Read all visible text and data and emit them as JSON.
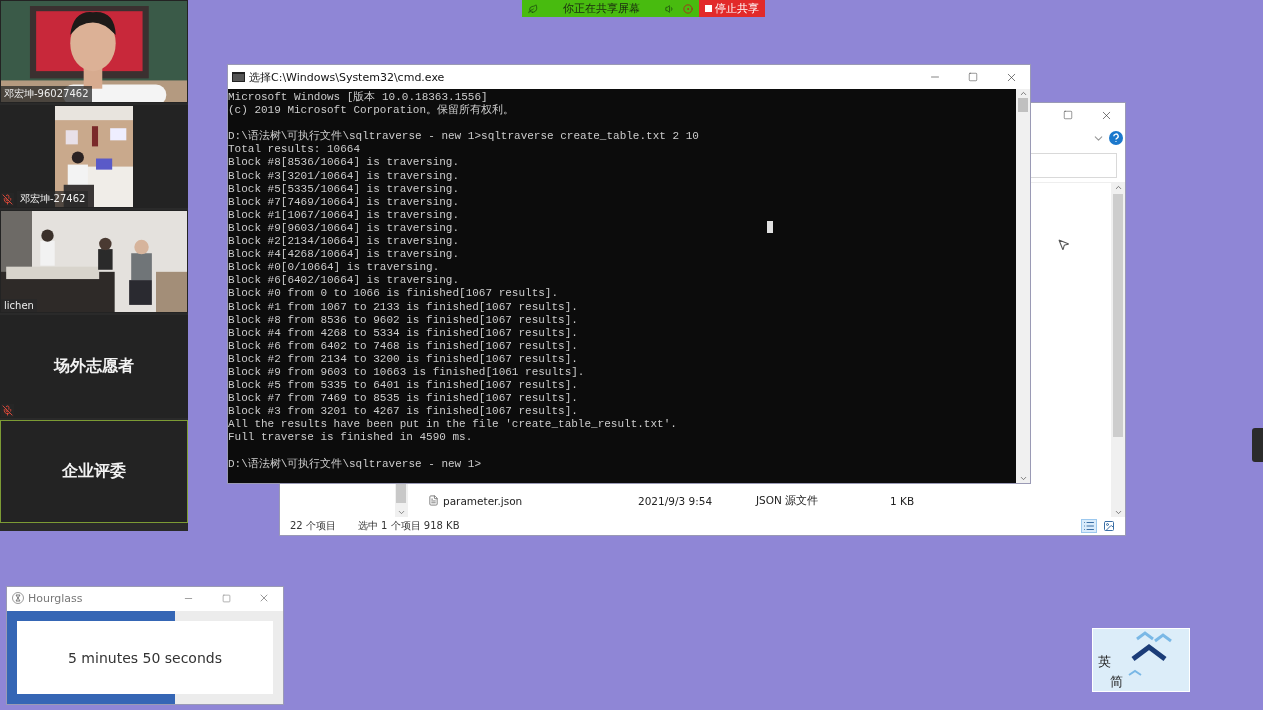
{
  "screen_share_bar": {
    "status": "你正在共享屏幕",
    "stop_button": "停止共享"
  },
  "participants": [
    {
      "kind": "video",
      "name": "邓宏坤-96027462",
      "muted": false,
      "selected": false
    },
    {
      "kind": "narrow_video",
      "name": "邓宏坤-27462",
      "muted": true,
      "selected": false
    },
    {
      "kind": "video",
      "name": "lichen",
      "muted": false,
      "selected": false
    },
    {
      "kind": "placeholder",
      "name": "场外志愿者",
      "muted": true,
      "selected": false
    },
    {
      "kind": "placeholder",
      "name": "企业评委",
      "muted": false,
      "selected": true
    }
  ],
  "cmd_window": {
    "title": "选择C:\\Windows\\System32\\cmd.exe",
    "blocks": [
      [
        "Microsoft Windows [版本 10.0.18363.1556]",
        "(c) 2019 Microsoft Corporation。保留所有权利。"
      ],
      [
        "D:\\语法树\\可执行文件\\sqltraverse - new 1>sqltraverse create_table.txt 2 10",
        "Total results: 10664",
        "Block #8[8536/10664] is traversing.",
        "Block #3[3201/10664] is traversing.",
        "Block #5[5335/10664] is traversing.",
        "Block #7[7469/10664] is traversing.",
        "Block #1[1067/10664] is traversing.",
        "Block #9[9603/10664] is traversing.",
        "Block #2[2134/10664] is traversing.",
        "Block #4[4268/10664] is traversing.",
        "Block #0[0/10664] is traversing.",
        "Block #6[6402/10664] is traversing.",
        "Block #0 from 0 to 1066 is finished[1067 results].",
        "Block #1 from 1067 to 2133 is finished[1067 results].",
        "Block #8 from 8536 to 9602 is finished[1067 results].",
        "Block #4 from 4268 to 5334 is finished[1067 results].",
        "Block #6 from 6402 to 7468 is finished[1067 results].",
        "Block #2 from 2134 to 3200 is finished[1067 results].",
        "Block #9 from 9603 to 10663 is finished[1061 results].",
        "Block #5 from 5335 to 6401 is finished[1067 results].",
        "Block #7 from 7469 to 8535 is finished[1067 results].",
        "Block #3 from 3201 to 4267 is finished[1067 results].",
        "All the results have been put in the file 'create_table_result.txt'.",
        "Full traverse is finished in 4590 ms."
      ],
      [
        "D:\\语法树\\可执行文件\\sqltraverse - new 1>"
      ]
    ]
  },
  "explorer_window": {
    "files": [
      {
        "name": "parameter.json",
        "date": "2021/9/3 9:54",
        "type": "JSON 源文件",
        "size": "1 KB"
      }
    ],
    "item_count": "22 个项目",
    "selection": "选中 1 个项目 918 KB"
  },
  "hourglass_window": {
    "title": "Hourglass",
    "level": 0.61,
    "remaining": "5 minutes 50 seconds"
  },
  "ime_indicator": {
    "mode": "英",
    "script": "简"
  }
}
